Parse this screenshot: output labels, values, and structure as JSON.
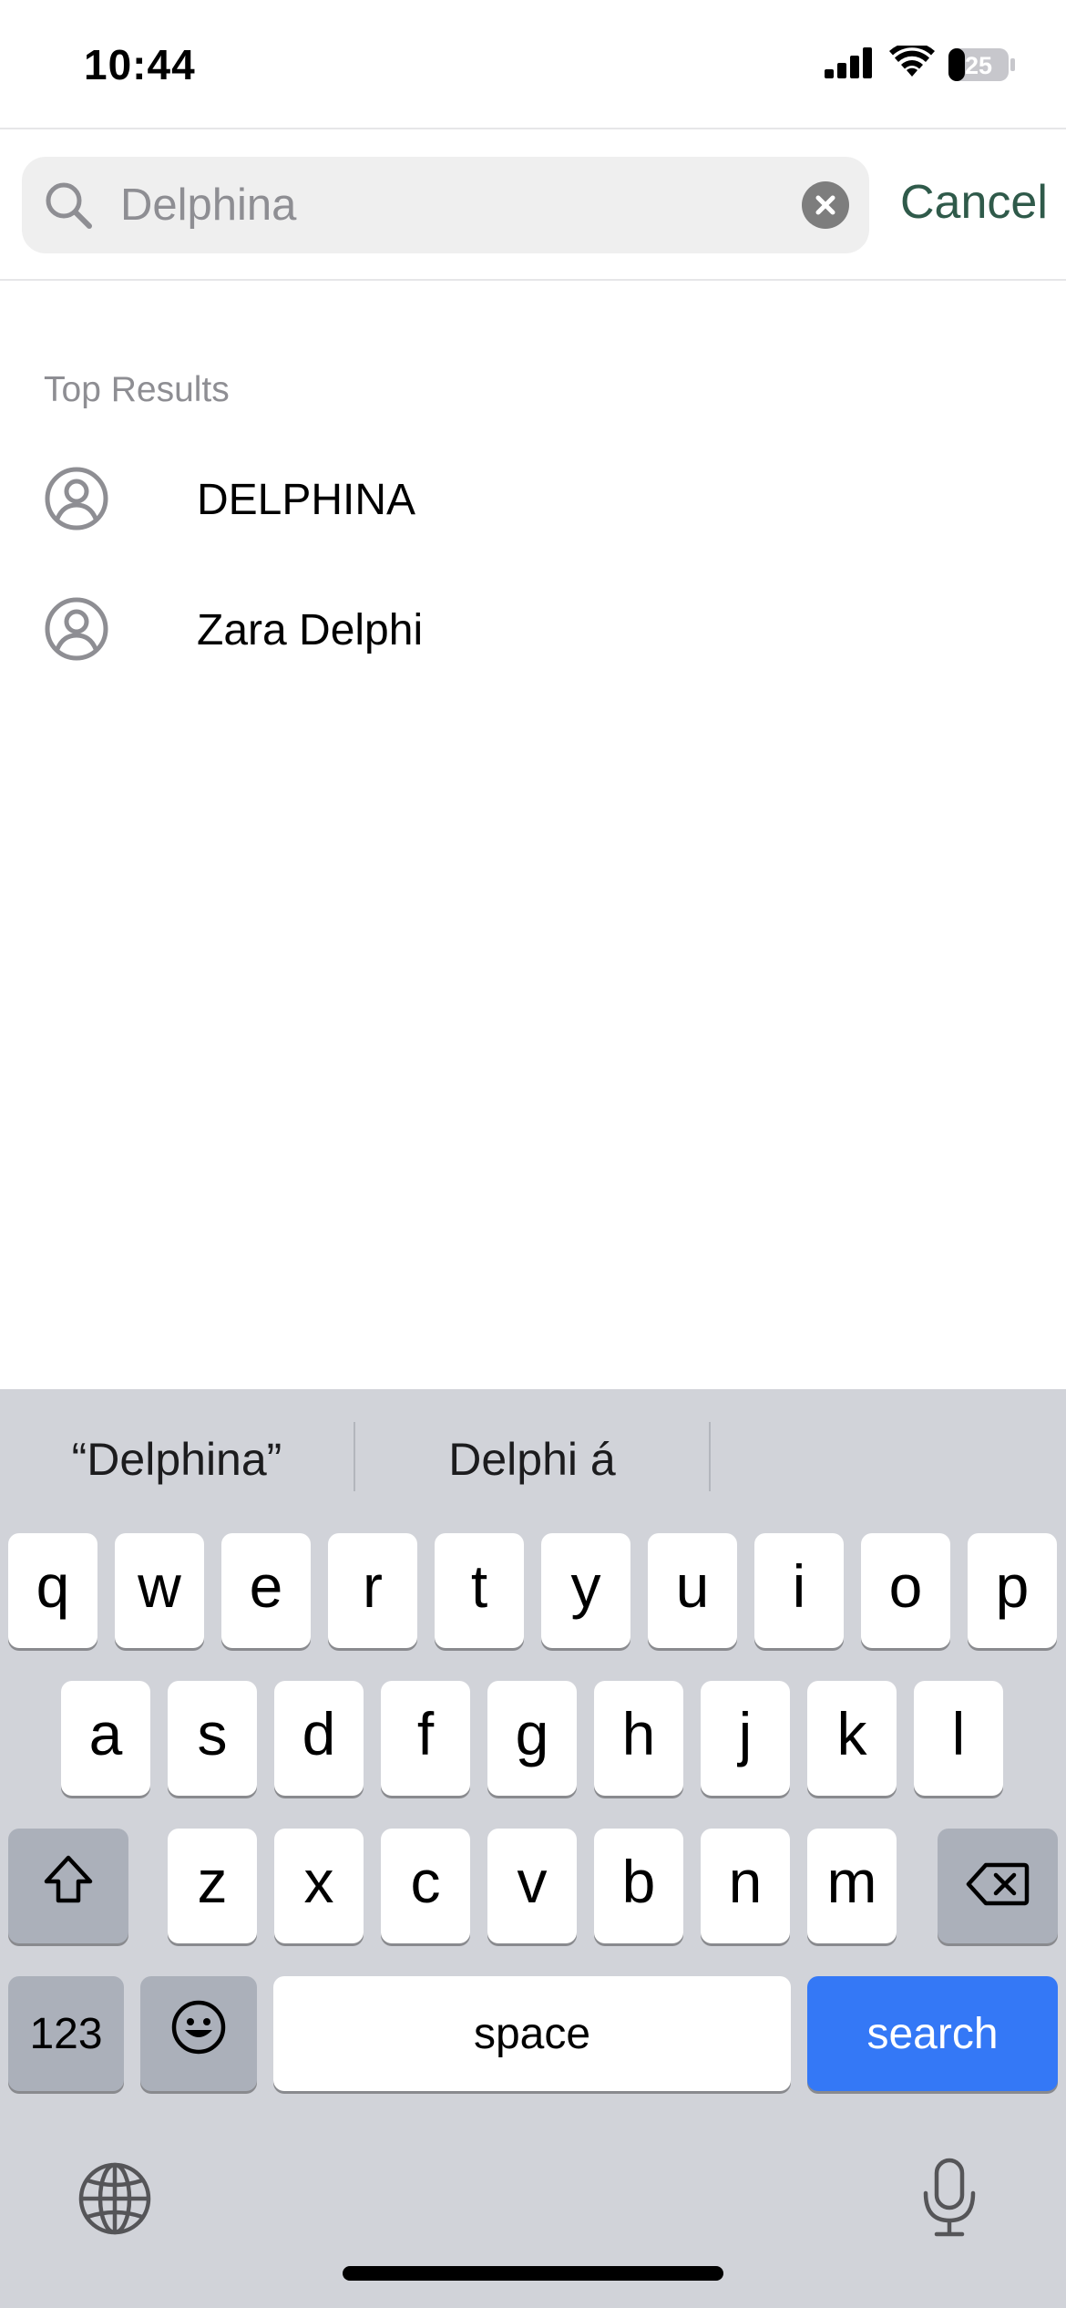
{
  "status_bar": {
    "time": "10:44",
    "battery_level": "25",
    "signal_icon": "cellular-signal-icon",
    "wifi_icon": "wifi-icon",
    "battery_icon": "battery-icon"
  },
  "search": {
    "query": "Delphina",
    "placeholder": "",
    "search_icon": "magnifier-icon",
    "clear_icon": "clear-x-icon",
    "cancel_label": "Cancel"
  },
  "results": {
    "section_label": "Top Results",
    "items": [
      {
        "name": "DELPHINA",
        "icon": "person-circle-icon"
      },
      {
        "name": "Zara Delphi",
        "icon": "person-circle-icon"
      }
    ]
  },
  "keyboard": {
    "suggestions": [
      "“Delphina”",
      "Delphi á",
      ""
    ],
    "row1": [
      "q",
      "w",
      "e",
      "r",
      "t",
      "y",
      "u",
      "i",
      "o",
      "p"
    ],
    "row2": [
      "a",
      "s",
      "d",
      "f",
      "g",
      "h",
      "j",
      "k",
      "l"
    ],
    "row3": [
      "z",
      "x",
      "c",
      "v",
      "b",
      "n",
      "m"
    ],
    "numbers_label": "123",
    "space_label": "space",
    "search_label": "search",
    "shift_icon": "shift-icon",
    "delete_icon": "backspace-icon",
    "emoji_icon": "emoji-icon",
    "globe_icon": "globe-icon",
    "mic_icon": "microphone-icon"
  },
  "colors": {
    "accent_green": "#2f5a4a",
    "search_key_blue": "#3478f6",
    "keyboard_background": "#d1d3d9",
    "secondary_text": "#8e8e93"
  }
}
